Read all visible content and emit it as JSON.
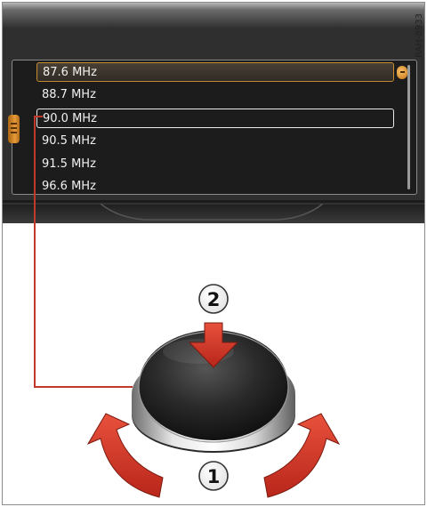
{
  "figure_code": "RAH-8933",
  "frequency_list": {
    "items": [
      {
        "label": "87.6 MHz",
        "state": "playing"
      },
      {
        "label": "88.7 MHz",
        "state": "normal"
      },
      {
        "label": "90.0 MHz",
        "state": "selected"
      },
      {
        "label": "90.5 MHz",
        "state": "normal"
      },
      {
        "label": "91.5 MHz",
        "state": "normal"
      },
      {
        "label": "96.6 MHz",
        "state": "normal"
      }
    ]
  },
  "controller": {
    "push_step_number": "2",
    "turn_step_number": "1"
  },
  "colors": {
    "screen_background": "#2f2f2f",
    "playing_accent": "#c68a2e",
    "callout_line": "#c0392b",
    "arrow_red": "#d63a2a"
  },
  "icons": {
    "playing_marker": "now-playing-icon",
    "side_tab": "menu-handle-icon",
    "push_arrow": "push-down-arrow-icon",
    "rotate_arrows": "rotate-arrows-icon"
  }
}
